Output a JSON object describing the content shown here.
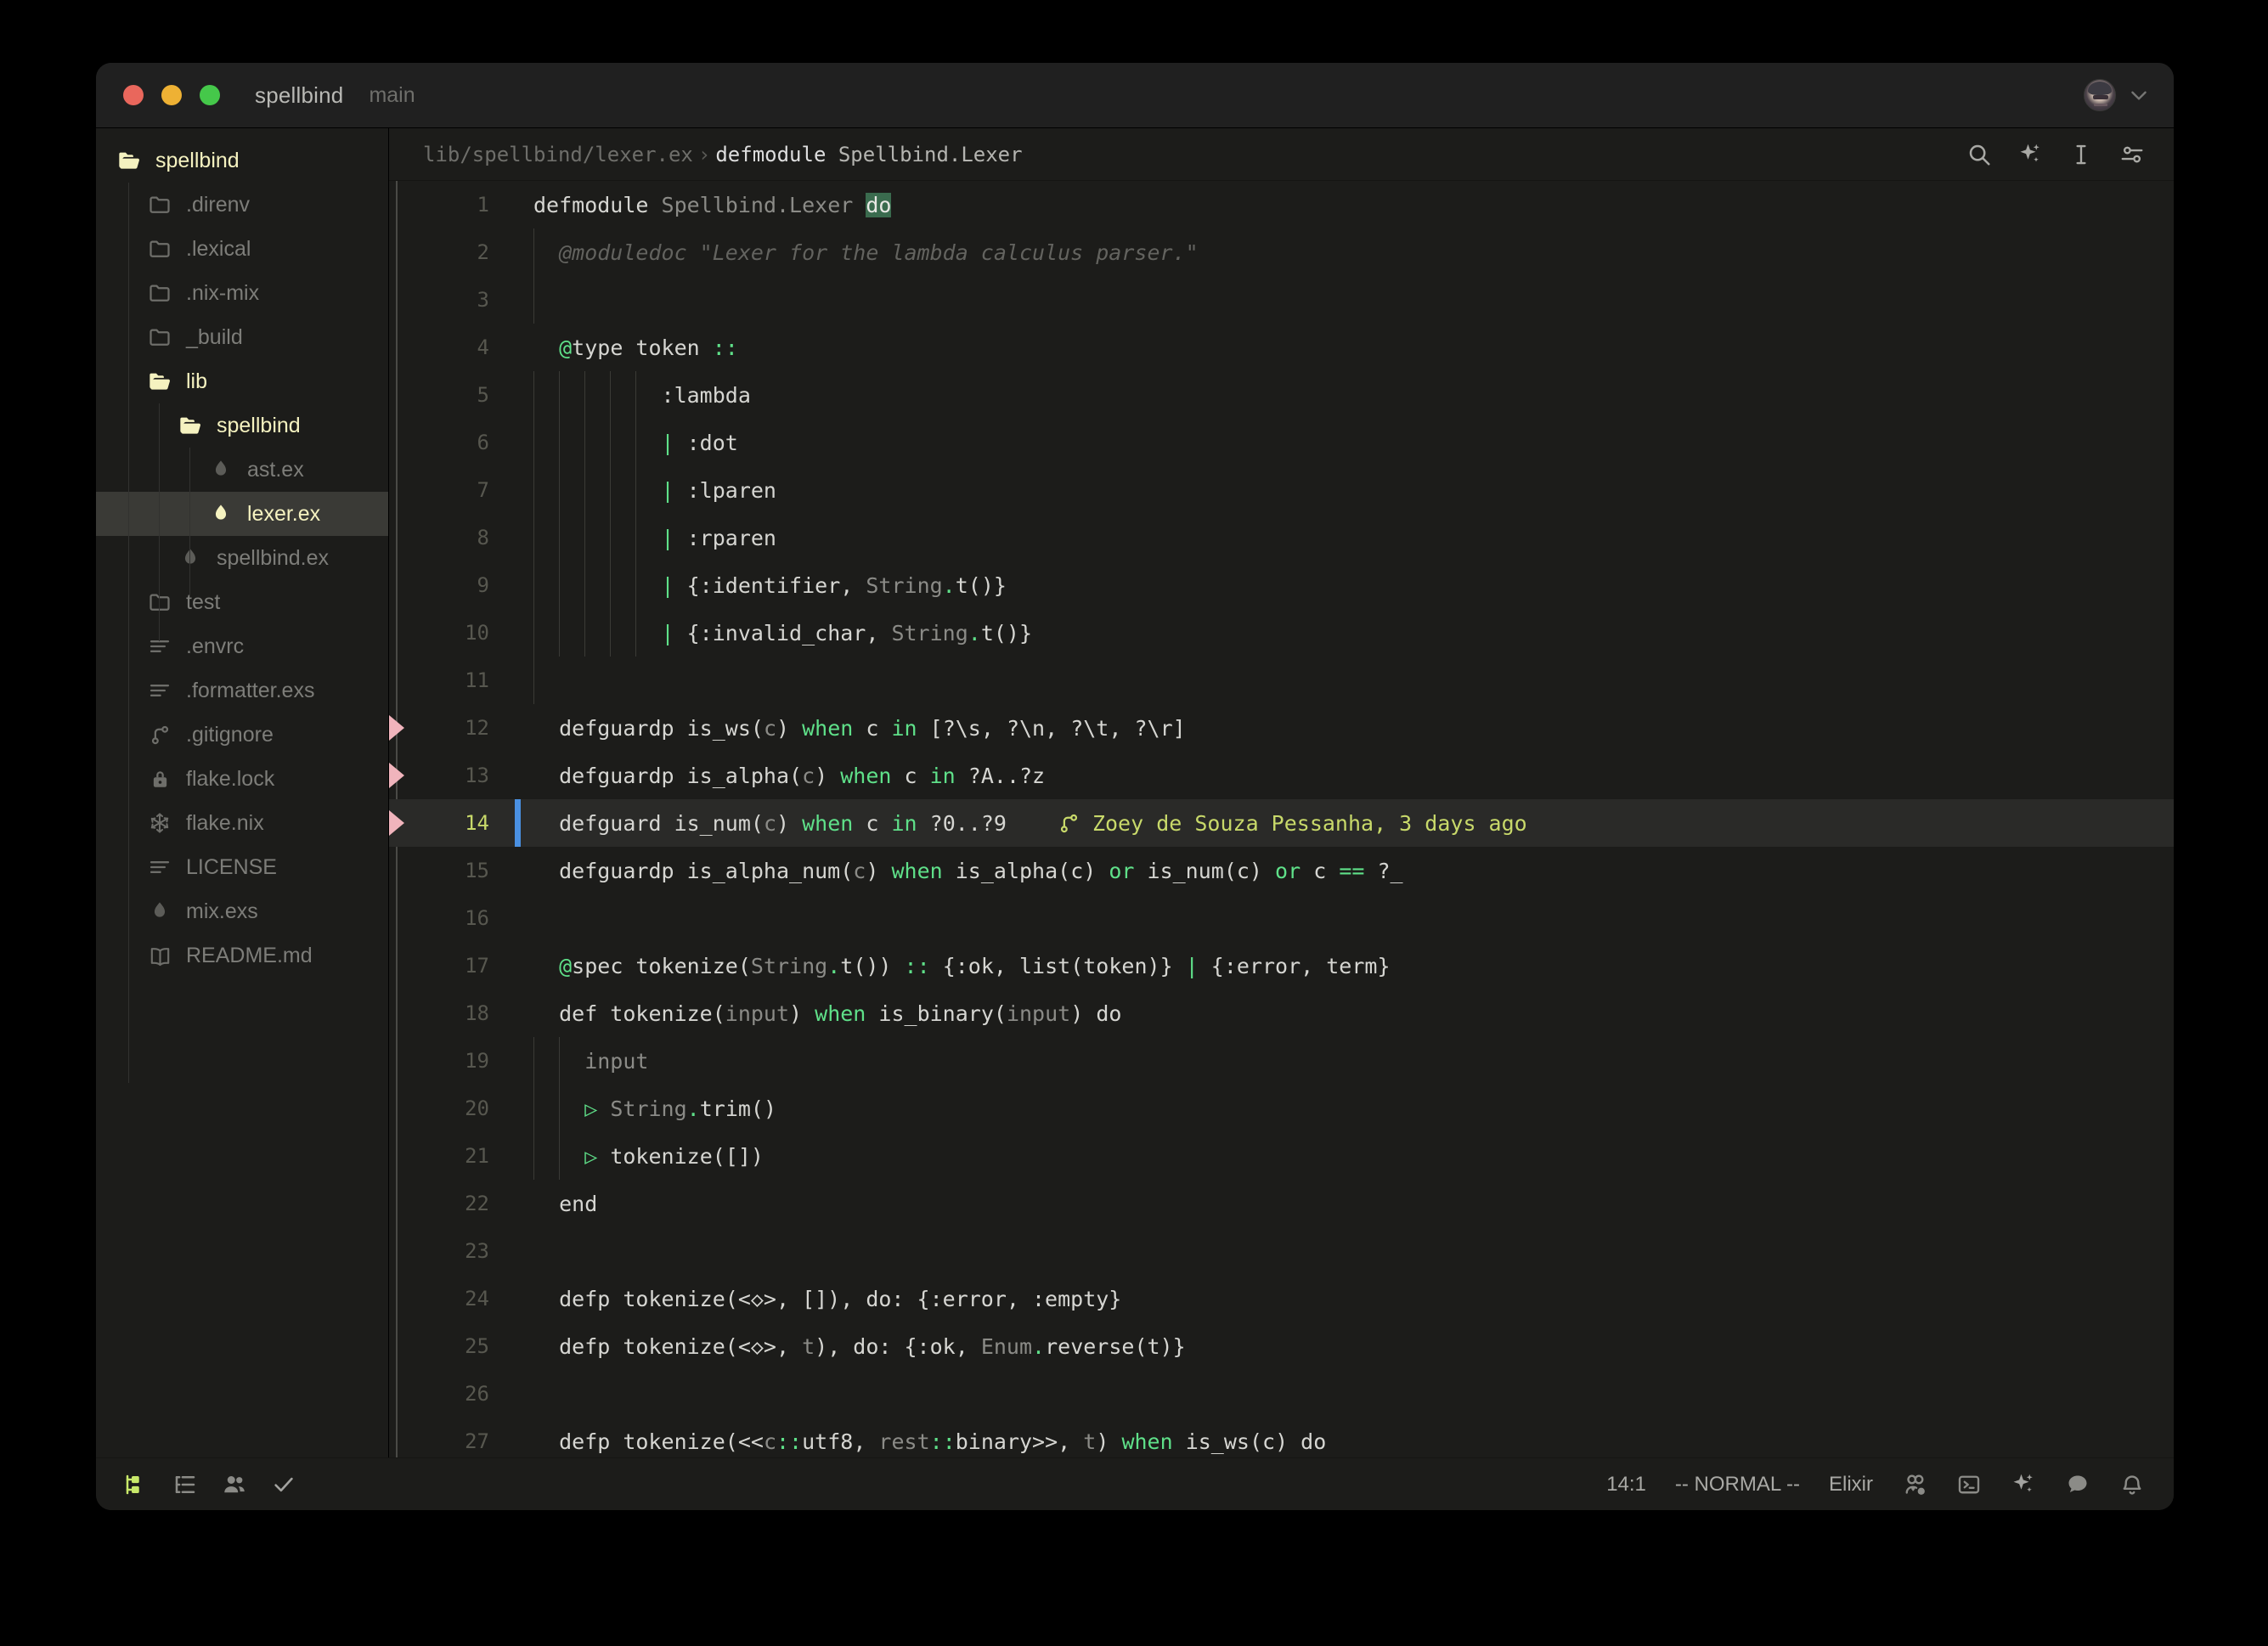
{
  "titlebar": {
    "project": "spellbind",
    "branch": "main",
    "avatar_name": "user-avatar",
    "chevron": "chevron-down-icon"
  },
  "sidebar": {
    "root": {
      "label": "spellbind",
      "icon": "folder-open-icon"
    },
    "items": [
      {
        "label": ".direnv",
        "icon": "folder-icon",
        "depth": 1,
        "state": "dim"
      },
      {
        "label": ".lexical",
        "icon": "folder-icon",
        "depth": 1,
        "state": "dim"
      },
      {
        "label": ".nix-mix",
        "icon": "folder-icon",
        "depth": 1,
        "state": "dim"
      },
      {
        "label": "_build",
        "icon": "folder-icon",
        "depth": 1,
        "state": "dim"
      },
      {
        "label": "lib",
        "icon": "folder-open-icon",
        "depth": 1,
        "state": "open"
      },
      {
        "label": "spellbind",
        "icon": "folder-open-icon",
        "depth": 2,
        "state": "open"
      },
      {
        "label": "ast.ex",
        "icon": "elixir-drop-icon",
        "depth": 3,
        "state": "dim"
      },
      {
        "label": "lexer.ex",
        "icon": "elixir-drop-icon",
        "depth": 3,
        "state": "selected"
      },
      {
        "label": "spellbind.ex",
        "icon": "elixir-drop-icon",
        "depth": 2,
        "state": "dim"
      },
      {
        "label": "test",
        "icon": "folder-icon",
        "depth": 1,
        "state": "dim"
      },
      {
        "label": ".envrc",
        "icon": "text-lines-icon",
        "depth": 1,
        "state": "dim"
      },
      {
        "label": ".formatter.exs",
        "icon": "text-lines-icon",
        "depth": 1,
        "state": "dim"
      },
      {
        "label": ".gitignore",
        "icon": "git-branch-icon",
        "depth": 1,
        "state": "dim"
      },
      {
        "label": "flake.lock",
        "icon": "lock-icon",
        "depth": 1,
        "state": "dim"
      },
      {
        "label": "flake.nix",
        "icon": "nix-snowflake-icon",
        "depth": 1,
        "state": "dim"
      },
      {
        "label": "LICENSE",
        "icon": "text-lines-icon",
        "depth": 1,
        "state": "dim"
      },
      {
        "label": "mix.exs",
        "icon": "elixir-drop-icon",
        "depth": 1,
        "state": "dim"
      },
      {
        "label": "README.md",
        "icon": "book-icon",
        "depth": 1,
        "state": "dim"
      }
    ]
  },
  "breadcrumb": {
    "path": "lib/spellbind/lexer.ex",
    "separator": "›",
    "symbol_keyword": "defmodule",
    "symbol_name": "Spellbind.Lexer"
  },
  "toolbar_icons": [
    {
      "name": "search-icon"
    },
    {
      "name": "ai-sparkle-icon"
    },
    {
      "name": "text-cursor-icon"
    },
    {
      "name": "settings-sliders-icon"
    }
  ],
  "editor": {
    "blame": {
      "icon": "git-branch-icon",
      "text": "Zoey de Souza Pessanha, 3 days ago"
    },
    "active_line": 14,
    "diff_marker_lines": [
      12,
      13,
      14
    ],
    "lines": [
      {
        "n": 1,
        "tokens": [
          {
            "t": "defmodule",
            "c": "kw"
          },
          {
            "t": " "
          },
          {
            "t": "Spellbind.Lexer",
            "c": "dim"
          },
          {
            "t": " "
          },
          {
            "t": "do",
            "c": "sel"
          }
        ]
      },
      {
        "n": 2,
        "indent": 1,
        "tokens": [
          {
            "t": "  @moduledoc \"Lexer for the lambda calculus parser.\"",
            "c": "cmt"
          }
        ]
      },
      {
        "n": 3,
        "indent": 1,
        "tokens": [
          {
            "t": ""
          }
        ]
      },
      {
        "n": 4,
        "tokens": [
          {
            "t": "  "
          },
          {
            "t": "@",
            "c": "grn"
          },
          {
            "t": "type token "
          },
          {
            "t": "::",
            "c": "grn"
          }
        ]
      },
      {
        "n": 5,
        "indent": 5,
        "tokens": [
          {
            "t": "          :lambda"
          }
        ]
      },
      {
        "n": 6,
        "indent": 5,
        "tokens": [
          {
            "t": "          "
          },
          {
            "t": "|",
            "c": "grn"
          },
          {
            "t": " :dot"
          }
        ]
      },
      {
        "n": 7,
        "indent": 5,
        "tokens": [
          {
            "t": "          "
          },
          {
            "t": "|",
            "c": "grn"
          },
          {
            "t": " :lparen"
          }
        ]
      },
      {
        "n": 8,
        "indent": 5,
        "tokens": [
          {
            "t": "          "
          },
          {
            "t": "|",
            "c": "grn"
          },
          {
            "t": " :rparen"
          }
        ]
      },
      {
        "n": 9,
        "indent": 5,
        "tokens": [
          {
            "t": "          "
          },
          {
            "t": "|",
            "c": "grn"
          },
          {
            "t": " {:identifier, "
          },
          {
            "t": "String",
            "c": "dim"
          },
          {
            "t": ".",
            "c": "grn"
          },
          {
            "t": "t()}"
          }
        ]
      },
      {
        "n": 10,
        "indent": 5,
        "tokens": [
          {
            "t": "          "
          },
          {
            "t": "|",
            "c": "grn"
          },
          {
            "t": " {:invalid_char, "
          },
          {
            "t": "String",
            "c": "dim"
          },
          {
            "t": ".",
            "c": "grn"
          },
          {
            "t": "t()}"
          }
        ]
      },
      {
        "n": 11,
        "indent": 1,
        "tokens": [
          {
            "t": ""
          }
        ]
      },
      {
        "n": 12,
        "tokens": [
          {
            "t": "  defguardp is_ws("
          },
          {
            "t": "c",
            "c": "dim"
          },
          {
            "t": ") "
          },
          {
            "t": "when",
            "c": "grn"
          },
          {
            "t": " c "
          },
          {
            "t": "in",
            "c": "grn"
          },
          {
            "t": " [?\\s, ?\\n, ?\\t, ?\\r]"
          }
        ]
      },
      {
        "n": 13,
        "tokens": [
          {
            "t": "  defguardp is_alpha("
          },
          {
            "t": "c",
            "c": "dim"
          },
          {
            "t": ") "
          },
          {
            "t": "when",
            "c": "grn"
          },
          {
            "t": " c "
          },
          {
            "t": "in",
            "c": "grn"
          },
          {
            "t": " ?A..?z"
          }
        ]
      },
      {
        "n": 14,
        "tokens": [
          {
            "t": "  defguard is_num("
          },
          {
            "t": "c",
            "c": "dim"
          },
          {
            "t": ") "
          },
          {
            "t": "when",
            "c": "grn"
          },
          {
            "t": " c "
          },
          {
            "t": "in",
            "c": "grn"
          },
          {
            "t": " ?0..?9"
          }
        ]
      },
      {
        "n": 15,
        "tokens": [
          {
            "t": "  defguardp is_alpha_num("
          },
          {
            "t": "c",
            "c": "dim"
          },
          {
            "t": ") "
          },
          {
            "t": "when",
            "c": "grn"
          },
          {
            "t": " is_alpha(c) "
          },
          {
            "t": "or",
            "c": "grn"
          },
          {
            "t": " is_num(c) "
          },
          {
            "t": "or",
            "c": "grn"
          },
          {
            "t": " c "
          },
          {
            "t": "==",
            "c": "grn"
          },
          {
            "t": " ?_"
          }
        ]
      },
      {
        "n": 16,
        "tokens": [
          {
            "t": ""
          }
        ]
      },
      {
        "n": 17,
        "tokens": [
          {
            "t": "  "
          },
          {
            "t": "@",
            "c": "grn"
          },
          {
            "t": "spec tokenize("
          },
          {
            "t": "String",
            "c": "dim"
          },
          {
            "t": ".",
            "c": "grn"
          },
          {
            "t": "t()) "
          },
          {
            "t": "::",
            "c": "grn"
          },
          {
            "t": " {:ok, list(token)} "
          },
          {
            "t": "|",
            "c": "grn"
          },
          {
            "t": " {:error, term}"
          }
        ]
      },
      {
        "n": 18,
        "tokens": [
          {
            "t": "  def tokenize("
          },
          {
            "t": "input",
            "c": "dim"
          },
          {
            "t": ") "
          },
          {
            "t": "when",
            "c": "grn"
          },
          {
            "t": " is_binary("
          },
          {
            "t": "input",
            "c": "dim"
          },
          {
            "t": ") do"
          }
        ]
      },
      {
        "n": 19,
        "indent": 2,
        "tokens": [
          {
            "t": "    input",
            "c": "dim"
          }
        ]
      },
      {
        "n": 20,
        "indent": 2,
        "tokens": [
          {
            "t": "    "
          },
          {
            "t": "▷",
            "c": "grn"
          },
          {
            "t": " "
          },
          {
            "t": "String",
            "c": "dim"
          },
          {
            "t": ".",
            "c": "grn"
          },
          {
            "t": "trim()"
          }
        ]
      },
      {
        "n": 21,
        "indent": 2,
        "tokens": [
          {
            "t": "    "
          },
          {
            "t": "▷",
            "c": "grn"
          },
          {
            "t": " tokenize([])"
          }
        ]
      },
      {
        "n": 22,
        "tokens": [
          {
            "t": "  end"
          }
        ]
      },
      {
        "n": 23,
        "tokens": [
          {
            "t": ""
          }
        ]
      },
      {
        "n": 24,
        "tokens": [
          {
            "t": "  defp tokenize(<◇>, []), do: {:error, :empty}"
          }
        ]
      },
      {
        "n": 25,
        "tokens": [
          {
            "t": "  defp tokenize(<◇>, "
          },
          {
            "t": "t",
            "c": "dim"
          },
          {
            "t": "), do: {:ok, "
          },
          {
            "t": "Enum",
            "c": "dim"
          },
          {
            "t": ".",
            "c": "grn"
          },
          {
            "t": "reverse(t)}"
          }
        ]
      },
      {
        "n": 26,
        "tokens": [
          {
            "t": ""
          }
        ]
      },
      {
        "n": 27,
        "tokens": [
          {
            "t": "  defp tokenize(<<"
          },
          {
            "t": "c",
            "c": "dim"
          },
          {
            "t": "::",
            "c": "grn"
          },
          {
            "t": "utf8, "
          },
          {
            "t": "rest",
            "c": "dim"
          },
          {
            "t": "::",
            "c": "grn"
          },
          {
            "t": "binary>>, "
          },
          {
            "t": "t",
            "c": "dim"
          },
          {
            "t": ") "
          },
          {
            "t": "when",
            "c": "grn"
          },
          {
            "t": " is_ws(c) do"
          }
        ]
      }
    ]
  },
  "statusbar": {
    "left_icons": [
      {
        "name": "project-panel-icon",
        "active": true
      },
      {
        "name": "outline-panel-icon",
        "active": false
      },
      {
        "name": "collaborators-icon",
        "active": false
      },
      {
        "name": "diagnostics-check-icon",
        "active": false
      }
    ],
    "cursor_position": "14:1",
    "vim_mode": "-- NORMAL --",
    "language": "Elixir",
    "right_icons": [
      {
        "name": "collab-call-icon"
      },
      {
        "name": "terminal-icon"
      },
      {
        "name": "ai-sparkle-icon"
      },
      {
        "name": "chat-bubble-icon"
      },
      {
        "name": "notification-bell-icon"
      }
    ]
  },
  "colors": {
    "accent_green": "#5fe089",
    "blame_olive": "#c8d96a",
    "cursor_blue": "#4a90e2",
    "selection_green": "#3a6b4e",
    "diff_pink": "#f0b4bc",
    "folder_cream": "#f5f2c0"
  }
}
